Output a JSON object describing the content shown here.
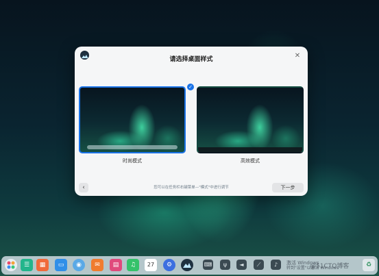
{
  "dialog": {
    "title": "请选择桌面样式",
    "close_glyph": "✕",
    "options": [
      {
        "label": "时尚模式",
        "selected": true
      },
      {
        "label": "高效模式",
        "selected": false
      }
    ],
    "check_glyph": "✓",
    "hint": "您可以在任务栏右键菜单—\"模式\"中进行调节",
    "back_glyph": "‹",
    "next_label": "下一步"
  },
  "dock": {
    "calendar_day": "27",
    "icons": [
      "launcher-icon",
      "file-manager-icon",
      "app-store-icon",
      "folder-icon",
      "browser-icon",
      "mail-icon",
      "photos-icon",
      "music-icon",
      "calendar-icon",
      "settings-icon",
      "deepin-icon"
    ],
    "tray": [
      "keyboard-icon",
      "usb-icon",
      "volume-icon",
      "network-icon",
      "notification-icon"
    ]
  },
  "watermark": {
    "line1": "激活 Windows",
    "line2": "转到\"设置\"以激活 Windows",
    "brand": "@51CTO博客"
  },
  "colors": {
    "accent": "#1a73e8",
    "modal_bg": "#f5f6f7"
  }
}
